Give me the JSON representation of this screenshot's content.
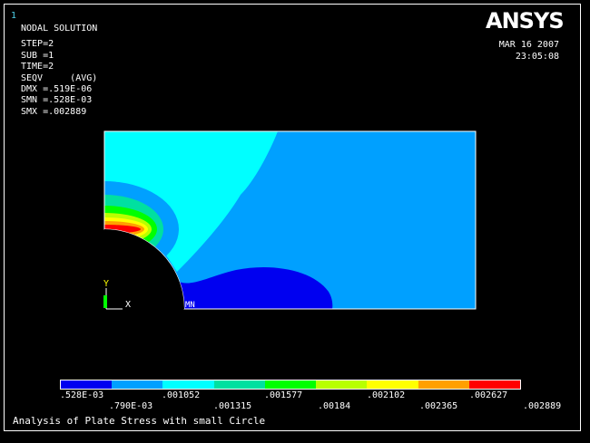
{
  "window_number": "1",
  "logo": "ANSYS",
  "solution_info": {
    "title": "NODAL SOLUTION",
    "lines": [
      "STEP=2",
      "SUB =1",
      "TIME=2",
      "SEQV     (AVG)",
      "DMX =.519E-06",
      "SMN =.528E-03",
      "SMX =.002889"
    ]
  },
  "date": "MAR 16 2007",
  "time": "23:05:08",
  "axes": {
    "y": "Y",
    "x": "X"
  },
  "markers": {
    "min": "MN"
  },
  "legend": {
    "colors": [
      "#0000f0",
      "#00a0ff",
      "#00ffff",
      "#00e0a0",
      "#00ff00",
      "#b8ff00",
      "#ffff00",
      "#ffa000",
      "#ff0000"
    ],
    "labels_top": [
      ".528E-03",
      ".001052",
      ".001577",
      ".002102",
      ".002627"
    ],
    "labels_bottom": [
      ".790E-03",
      ".001315",
      ".00184",
      ".002365",
      ".002889"
    ]
  },
  "caption": "Analysis of Plate Stress with small Circle"
}
